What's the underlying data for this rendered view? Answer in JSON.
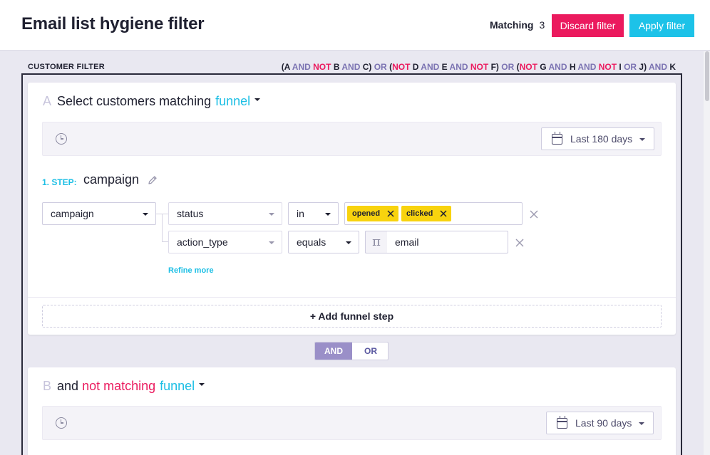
{
  "header": {
    "title": "Email list hygiene filter",
    "matching_label": "Matching",
    "matching_count": "3",
    "discard_label": "Discard filter",
    "apply_label": "Apply filter"
  },
  "filter": {
    "section_label": "CUSTOMER FILTER",
    "expression": [
      {
        "t": "(A ",
        "c": "plain"
      },
      {
        "t": "AND ",
        "c": "op"
      },
      {
        "t": "NOT ",
        "c": "neg"
      },
      {
        "t": "B ",
        "c": "plain"
      },
      {
        "t": "AND ",
        "c": "op"
      },
      {
        "t": "C) ",
        "c": "plain"
      },
      {
        "t": "OR ",
        "c": "op"
      },
      {
        "t": "(",
        "c": "plain"
      },
      {
        "t": "NOT ",
        "c": "neg"
      },
      {
        "t": "D ",
        "c": "plain"
      },
      {
        "t": "AND ",
        "c": "op"
      },
      {
        "t": "E ",
        "c": "plain"
      },
      {
        "t": "AND ",
        "c": "op"
      },
      {
        "t": "NOT ",
        "c": "neg"
      },
      {
        "t": "F) ",
        "c": "plain"
      },
      {
        "t": "OR ",
        "c": "op"
      },
      {
        "t": "(",
        "c": "plain"
      },
      {
        "t": "NOT ",
        "c": "neg"
      },
      {
        "t": "G ",
        "c": "plain"
      },
      {
        "t": "AND ",
        "c": "op"
      },
      {
        "t": "H ",
        "c": "plain"
      },
      {
        "t": "AND ",
        "c": "op"
      },
      {
        "t": "NOT ",
        "c": "neg"
      },
      {
        "t": "I ",
        "c": "plain"
      },
      {
        "t": "OR ",
        "c": "op"
      },
      {
        "t": "J) ",
        "c": "plain"
      },
      {
        "t": "AND ",
        "c": "op"
      },
      {
        "t": "K",
        "c": "plain"
      }
    ]
  },
  "card_a": {
    "letter": "A",
    "heading": "Select customers matching",
    "type": "funnel",
    "date_range": "Last 180 days",
    "step_label": "1. STEP:",
    "step_name": "campaign",
    "event": "campaign",
    "conditions": [
      {
        "property": "status",
        "operator": "in",
        "tags": [
          "opened",
          "clicked"
        ]
      },
      {
        "property": "action_type",
        "operator": "equals",
        "value": "email"
      }
    ],
    "refine_label": "Refine more",
    "add_step_label": "+ Add funnel step"
  },
  "combinator": {
    "and_label": "AND",
    "or_label": "OR",
    "selected": "AND"
  },
  "card_b": {
    "letter": "B",
    "heading_prefix": "and",
    "heading_neg": "not matching",
    "type": "funnel",
    "date_range": "Last 90 days"
  },
  "colors": {
    "accent": "#1dc2e8",
    "danger": "#eb1a5e",
    "tag": "#f8d30e",
    "operator": "#7b73b2",
    "and_selected": "#9a8fc8"
  }
}
